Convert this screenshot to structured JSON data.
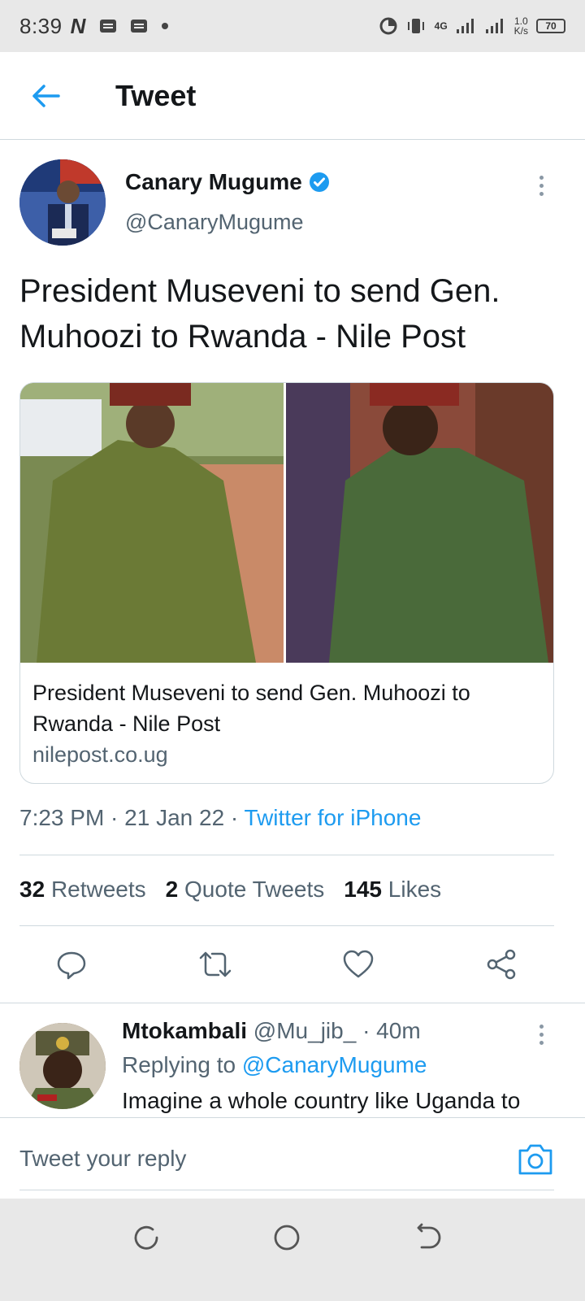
{
  "status_bar": {
    "time": "8:39",
    "network": "4G",
    "speed_value": "1.0",
    "speed_unit": "K/s",
    "battery": "70"
  },
  "header": {
    "title": "Tweet"
  },
  "tweet": {
    "author_name": "Canary Mugume",
    "author_handle": "@CanaryMugume",
    "text": "President Museveni to send Gen. Muhoozi to Rwanda - Nile Post",
    "card": {
      "title": "President Museveni to send Gen. Muhoozi to Rwanda - Nile Post",
      "domain": "nilepost.co.ug"
    },
    "time": "7:23 PM · 21 Jan 22 · ",
    "source": "Twitter for iPhone",
    "stats": {
      "retweets_count": "32",
      "retweets_label": "Retweets",
      "quotes_count": "2",
      "quotes_label": "Quote Tweets",
      "likes_count": "145",
      "likes_label": "Likes"
    }
  },
  "reply": {
    "name": "Mtokambali",
    "meta": " @Mu_jib_ · 40m",
    "replying_label": "Replying to ",
    "replying_to": "@CanaryMugume",
    "text": "Imagine a whole country like Uganda to"
  },
  "compose": {
    "placeholder": "Tweet your reply"
  },
  "colors": {
    "accent": "#1d9bf0",
    "secondary_text": "#536471",
    "border": "#cfd9de"
  }
}
